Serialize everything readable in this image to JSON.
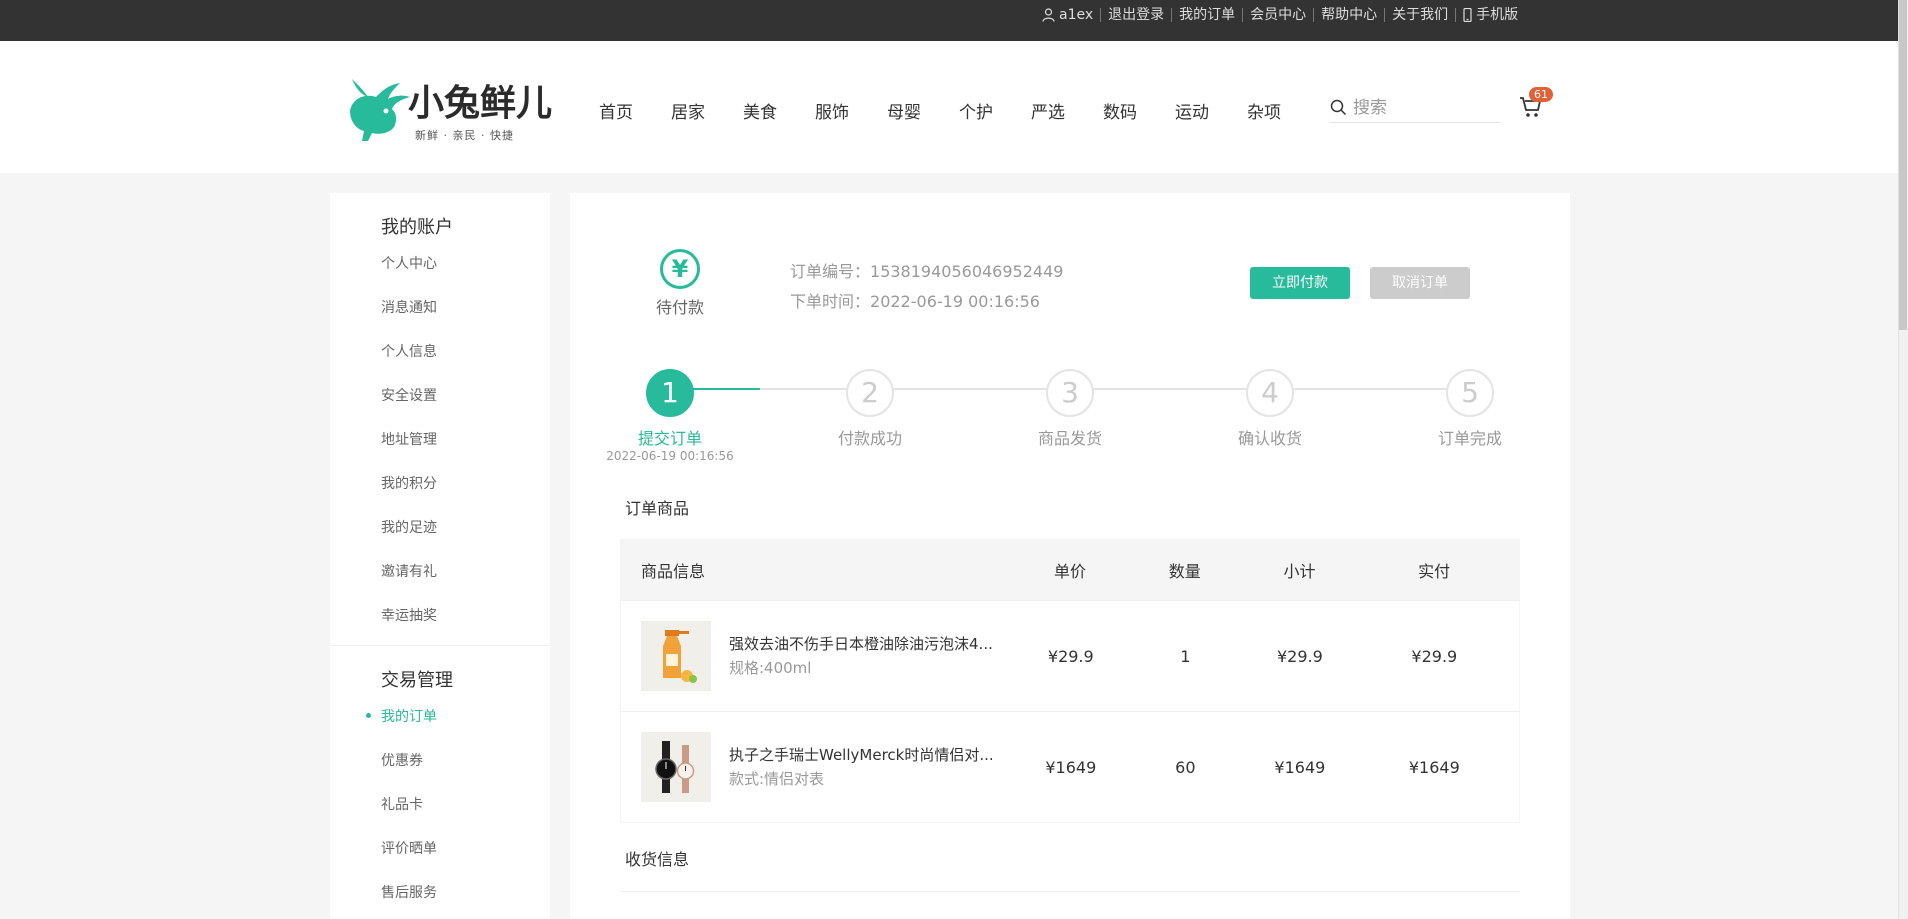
{
  "topbar": {
    "username": "a1ex",
    "links": [
      "退出登录",
      "我的订单",
      "会员中心",
      "帮助中心",
      "关于我们",
      "手机版"
    ]
  },
  "header": {
    "logo_text": "小兔鲜儿",
    "logo_slogan": "新鲜 · 亲民 · 快捷",
    "nav": [
      "首页",
      "居家",
      "美食",
      "服饰",
      "母婴",
      "个护",
      "严选",
      "数码",
      "运动",
      "杂项"
    ],
    "search_placeholder": "搜索",
    "cart_count": "61"
  },
  "sidebar": {
    "account_title": "我的账户",
    "account_items": [
      "个人中心",
      "消息通知",
      "个人信息",
      "安全设置",
      "地址管理",
      "我的积分",
      "我的足迹",
      "邀请有礼",
      "幸运抽奖"
    ],
    "trade_title": "交易管理",
    "trade_items": [
      "我的订单",
      "优惠券",
      "礼品卡",
      "评价晒单",
      "售后服务"
    ],
    "active_item": "我的订单"
  },
  "order": {
    "status_icon": "¥",
    "status_label": "待付款",
    "order_no_label": "订单编号：",
    "order_no": "1538194056046952449",
    "order_time_label": "下单时间：",
    "order_time": "2022-06-19 00:16:56",
    "pay_button": "立即付款",
    "cancel_button": "取消订单"
  },
  "steps": [
    {
      "num": "1",
      "label": "提交订单",
      "time": "2022-06-19 00:16:56",
      "done": true
    },
    {
      "num": "2",
      "label": "付款成功",
      "time": "",
      "done": false
    },
    {
      "num": "3",
      "label": "商品发货",
      "time": "",
      "done": false
    },
    {
      "num": "4",
      "label": "确认收货",
      "time": "",
      "done": false
    },
    {
      "num": "5",
      "label": "订单完成",
      "time": "",
      "done": false
    }
  ],
  "goods_section_title": "订单商品",
  "goods_table": {
    "headers": [
      "商品信息",
      "单价",
      "数量",
      "小计",
      "实付"
    ],
    "rows": [
      {
        "name": "强效去油不伤手日本橙油除油污泡沫4...",
        "attr": "规格:400ml",
        "price": "¥29.9",
        "count": "1",
        "subtotal": "¥29.9",
        "real": "¥29.9"
      },
      {
        "name": "执子之手瑞士WellyMerck时尚情侣对...",
        "attr": "款式:情侣对表",
        "price": "¥1649",
        "count": "60",
        "subtotal": "¥1649",
        "real": "¥1649"
      }
    ]
  },
  "shipping_section_title": "收货信息",
  "colors": {
    "accent": "#27ba9b",
    "topbar_bg": "#333333",
    "badge": "#e26237",
    "disabled_button": "#cccccc"
  }
}
